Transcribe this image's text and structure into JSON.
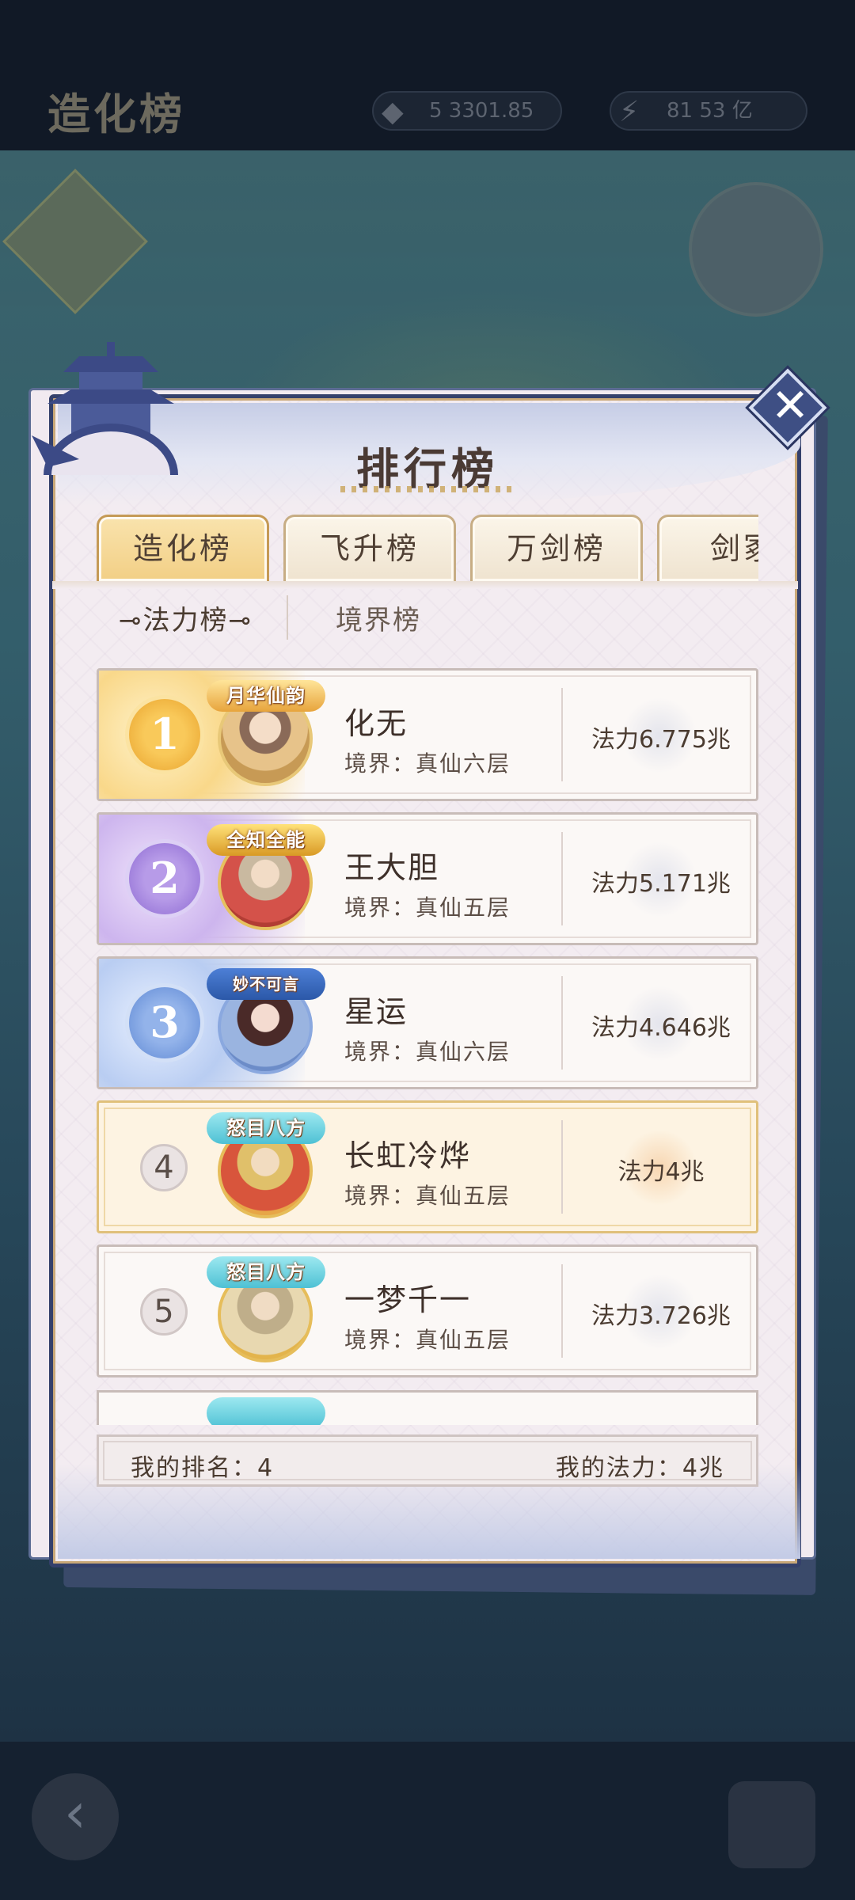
{
  "background": {
    "title": "造化榜",
    "resource1": "5 3301.85",
    "resource2": "81 53 亿"
  },
  "panel": {
    "title": "排行榜",
    "close_label": "✕",
    "tabs": [
      "造化榜",
      "飞升榜",
      "万剑榜",
      "剑冢"
    ],
    "active_tab": "造化榜",
    "subtabs": [
      "法力榜",
      "境界榜"
    ],
    "active_subtab": "法力榜"
  },
  "rankings": [
    {
      "rank": "1",
      "name": "化无",
      "realm": "境界：真仙六层",
      "power": "法力6.775兆",
      "frame_tag": "月华仙韵"
    },
    {
      "rank": "2",
      "name": "王大胆",
      "realm": "境界：真仙五层",
      "power": "法力5.171兆",
      "frame_tag": "全知全能"
    },
    {
      "rank": "3",
      "name": "星运",
      "realm": "境界：真仙六层",
      "power": "法力4.646兆",
      "frame_tag": "妙不可言"
    },
    {
      "rank": "4",
      "name": "长虹冷烨",
      "realm": "境界：真仙五层",
      "power": "法力4兆",
      "frame_tag": "怒目八方"
    },
    {
      "rank": "5",
      "name": "一梦千一",
      "realm": "境界：真仙五层",
      "power": "法力3.726兆",
      "frame_tag": "怒目八方"
    }
  ],
  "footer": {
    "my_rank": "我的排名：4",
    "my_power": "我的法力：4兆"
  },
  "colors": {
    "panel_border": "#34406b",
    "active_tab": "#f2cf85",
    "highlight_row": "#fdf3e2"
  }
}
